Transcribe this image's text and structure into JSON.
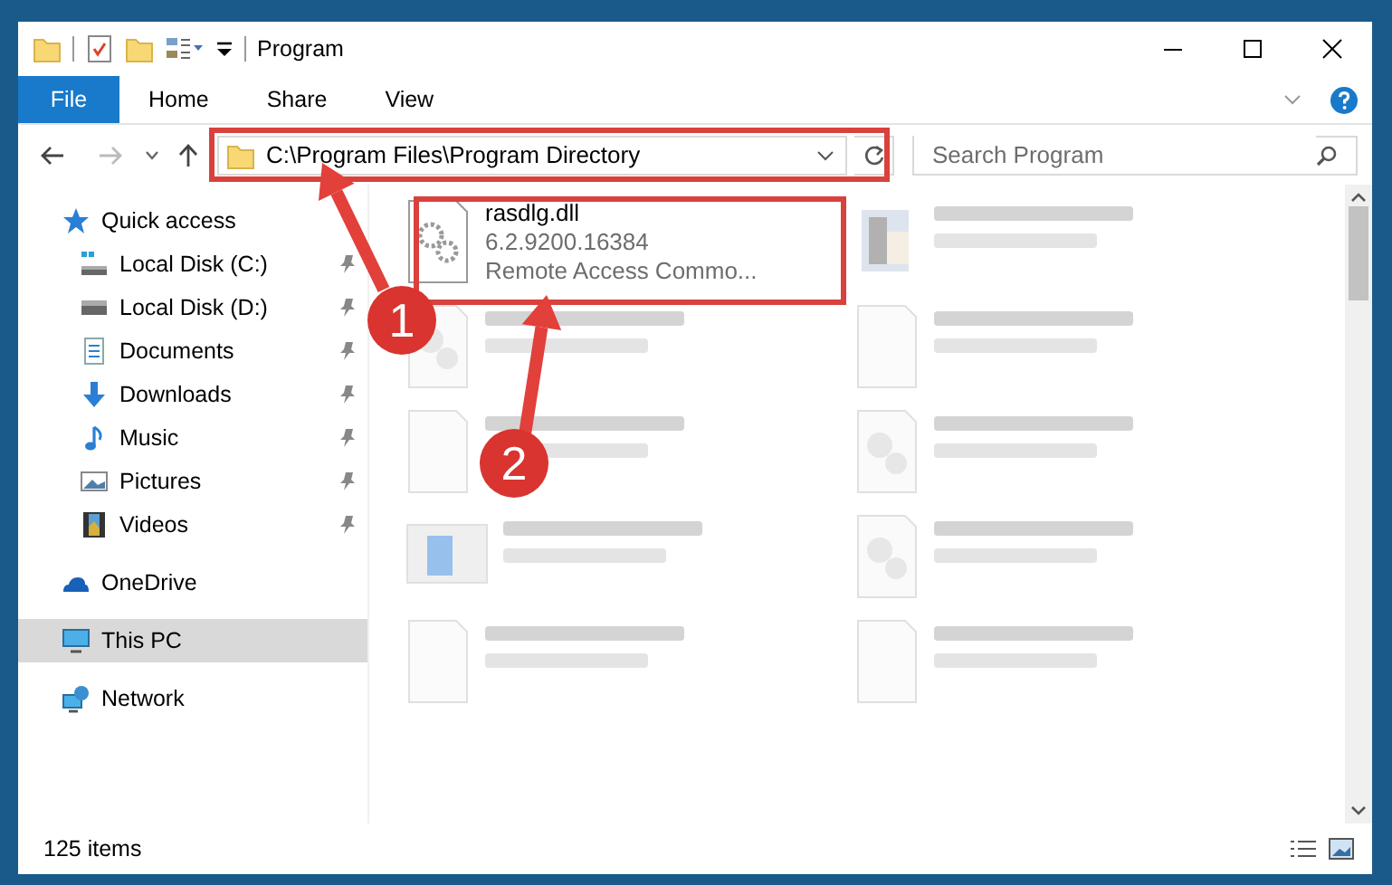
{
  "window": {
    "title": "Program"
  },
  "ribbon_tabs": [
    {
      "label": "File",
      "kind": "backstage"
    },
    {
      "label": "Home",
      "kind": "tab"
    },
    {
      "label": "Share",
      "kind": "tab"
    },
    {
      "label": "View",
      "kind": "tab"
    }
  ],
  "address": {
    "path": "C:\\Program Files\\Program Directory"
  },
  "search": {
    "placeholder": "Search Program"
  },
  "nav": [
    {
      "label": "Quick access",
      "kind": "star",
      "selected": false,
      "children": [
        {
          "label": "Local Disk (C:)",
          "kind": "system-drive",
          "pinned": true
        },
        {
          "label": "Local Disk (D:)",
          "kind": "drive",
          "pinned": true
        },
        {
          "label": "Documents",
          "kind": "documents",
          "pinned": true
        },
        {
          "label": "Downloads",
          "kind": "downloads",
          "pinned": true
        },
        {
          "label": "Music",
          "kind": "music",
          "pinned": true
        },
        {
          "label": "Pictures",
          "kind": "pictures",
          "pinned": true
        },
        {
          "label": "Videos",
          "kind": "videos",
          "pinned": true
        }
      ]
    },
    {
      "label": "OneDrive",
      "kind": "cloud",
      "selected": false
    },
    {
      "label": "This PC",
      "kind": "computer",
      "selected": true
    },
    {
      "label": "Network",
      "kind": "network",
      "selected": false
    }
  ],
  "files": [
    {
      "name": "rasdlg.dll",
      "details": [
        "6.2.9200.16384",
        "Remote Access Commo..."
      ],
      "kind": "dll",
      "blurred": false
    },
    {
      "kind": "exe",
      "blurred": true
    },
    {
      "kind": "resource",
      "blurred": true
    },
    {
      "kind": "file",
      "blurred": true
    },
    {
      "kind": "file",
      "blurred": true
    },
    {
      "kind": "resource",
      "blurred": true
    },
    {
      "kind": "app",
      "blurred": true
    },
    {
      "kind": "resource",
      "blurred": true
    },
    {
      "kind": "file",
      "blurred": true
    },
    {
      "kind": "file",
      "blurred": true
    }
  ],
  "status_bar": {
    "count": "125 items"
  },
  "callouts": [
    {
      "number": "1"
    },
    {
      "number": "2"
    }
  ]
}
